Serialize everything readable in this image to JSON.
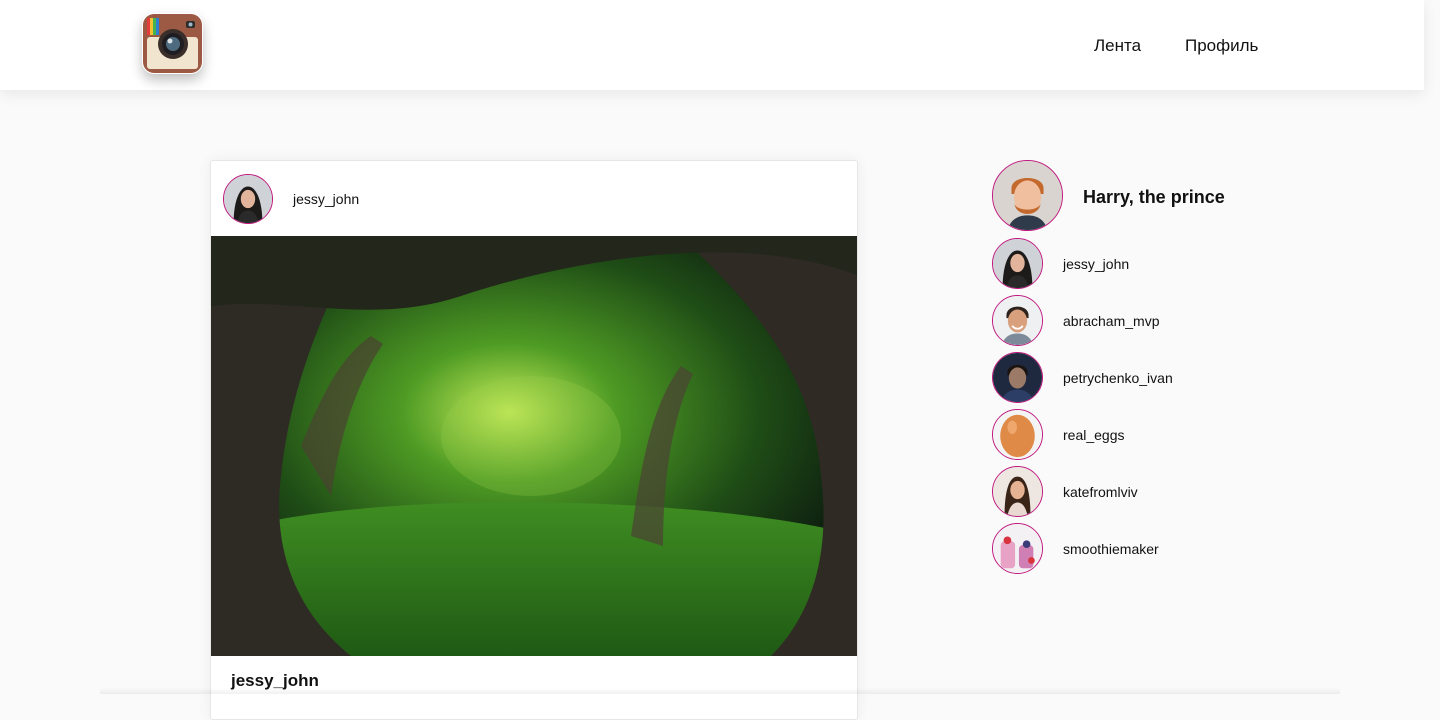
{
  "header": {
    "logo_icon": "instagram-camera-logo",
    "nav": {
      "feed_label": "Лента",
      "profile_label": "Профиль"
    }
  },
  "post": {
    "author": "jessy_john",
    "image_icon": "forest-photo",
    "caption_user": "jessy_john"
  },
  "sidebar": {
    "current_user": {
      "name": "Harry, the prince"
    },
    "suggestions": [
      {
        "name": "jessy_john"
      },
      {
        "name": "abracham_mvp"
      },
      {
        "name": "petrychenko_ivan"
      },
      {
        "name": "real_eggs"
      },
      {
        "name": "katefromlviv"
      },
      {
        "name": "smoothiemaker"
      }
    ]
  },
  "colors": {
    "avatar_ring": "#c2187f",
    "page_bg": "#fafafa"
  }
}
